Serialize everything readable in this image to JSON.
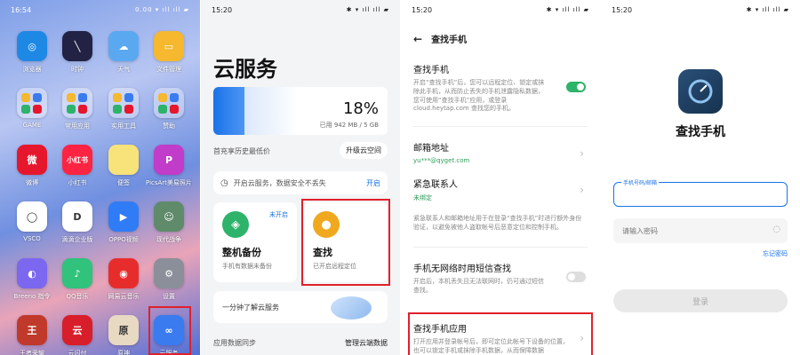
{
  "home": {
    "time": "16:54",
    "status_icons": "0.00 ▾ ıll ıll ▰",
    "apps": [
      {
        "label": "浏览器",
        "glyph": "◎",
        "color": "#1e88e5"
      },
      {
        "label": "时钟",
        "glyph": "╲",
        "color": "#222244"
      },
      {
        "label": "天气",
        "glyph": "☁",
        "color": "#5aa9f0"
      },
      {
        "label": "文件管理",
        "glyph": "▭",
        "color": "#f5b82e"
      },
      {
        "label": "GAME",
        "glyph": "",
        "color": ""
      },
      {
        "label": "常用应用",
        "glyph": "",
        "color": ""
      },
      {
        "label": "实用工具",
        "glyph": "",
        "color": ""
      },
      {
        "label": "赞助",
        "glyph": "",
        "color": ""
      },
      {
        "label": "微博",
        "glyph": "微",
        "color": "#e6162d"
      },
      {
        "label": "小红书",
        "glyph": "小红书",
        "color": "#ff2442"
      },
      {
        "label": "便签",
        "glyph": "",
        "color": "#f8e27a"
      },
      {
        "label": "PicsArt美易照片编辑",
        "glyph": "P",
        "color": "#c13cc9"
      },
      {
        "label": "VSCO",
        "glyph": "◯",
        "color": "#ffffff"
      },
      {
        "label": "滴滴企业版",
        "glyph": "D",
        "color": "#ffffff"
      },
      {
        "label": "OPPO视频",
        "glyph": "▶",
        "color": "#2f7cf6"
      },
      {
        "label": "现代战争",
        "glyph": "☺",
        "color": "#5f8b6a"
      },
      {
        "label": "Breeno 指令",
        "glyph": "◐",
        "color": "#7b67f0"
      },
      {
        "label": "QQ音乐",
        "glyph": "♪",
        "color": "#31c27c"
      },
      {
        "label": "网易云音乐",
        "glyph": "◉",
        "color": "#e72d2c"
      },
      {
        "label": "设置",
        "glyph": "⚙",
        "color": "#8a8f99"
      },
      {
        "label": "王者荣耀",
        "glyph": "王",
        "color": "#c0392b"
      },
      {
        "label": "云闪付",
        "glyph": "云",
        "color": "#d81e2a"
      },
      {
        "label": "原神",
        "glyph": "原",
        "color": "#e8d9c2"
      },
      {
        "label": "云服务",
        "glyph": "∞",
        "color": "#3a7bf0"
      }
    ]
  },
  "cloud": {
    "time": "15:20",
    "status_icons": "✱ ▾ ıll ıll ▰",
    "title": "云服务",
    "storage_percent": "18%",
    "storage_fraction": 0.18,
    "storage_used": "已用 942 MB / 5 GB",
    "history_text": "首充享历史最低价",
    "upgrade_label": "升级云空间",
    "notice_text": "开启云服务，数据安全不丢失",
    "notice_action": "开启",
    "backup_badge": "未开启",
    "backup_title": "整机备份",
    "backup_sub": "手机有数据未备份",
    "find_title": "查找",
    "find_sub": "已开启远程定位",
    "promo_text": "一分钟了解云服务",
    "sync_label": "应用数据同步",
    "manage_label": "管理云端数据"
  },
  "find": {
    "time": "15:20",
    "status_icons": "✱ ▾ ıll ıll ▰",
    "back_glyph": "←",
    "title": "查找手机",
    "rows": [
      {
        "title": "查找手机",
        "desc": "开启“查找手机”后，您可以远程定位、锁定或抹除此手机，从而防止丢失的手机泄露隐私数据，您可使用“查找手机”应用，或登录 cloud.heytap.com 查找您的手机。"
      },
      {
        "title": "邮箱地址",
        "value": "yu***@qyget.com"
      },
      {
        "title": "紧急联系人",
        "value": "未绑定"
      },
      {
        "desc": "紧急联系人和邮箱地址用于在登录“查找手机”时进行额外身份验证，以避免被他人盗取帐号后恶意定位和控制手机。"
      },
      {
        "title": "手机无网络时用短信查找",
        "desc": "开启后，本机丢失且无法联网时，仍可通过短信查找。"
      },
      {
        "title": "查找手机应用",
        "desc": "打开应用并登录帐号后，即可定位此帐号下设备的位置，也可以锁定手机或抹除手机数据，从而保障数据"
      }
    ]
  },
  "login": {
    "time": "15:20",
    "status_icons": "✱ ▾ ıll ıll ▰",
    "title": "查找手机",
    "account_label": "手机号码/邮箱",
    "password_placeholder": "请输入密码",
    "forgot_label": "忘记密码",
    "login_label": "登录"
  },
  "colors": {
    "accent": "#1a73e8",
    "highlight": "#e0212a",
    "toggle_on": "#2db36a"
  }
}
